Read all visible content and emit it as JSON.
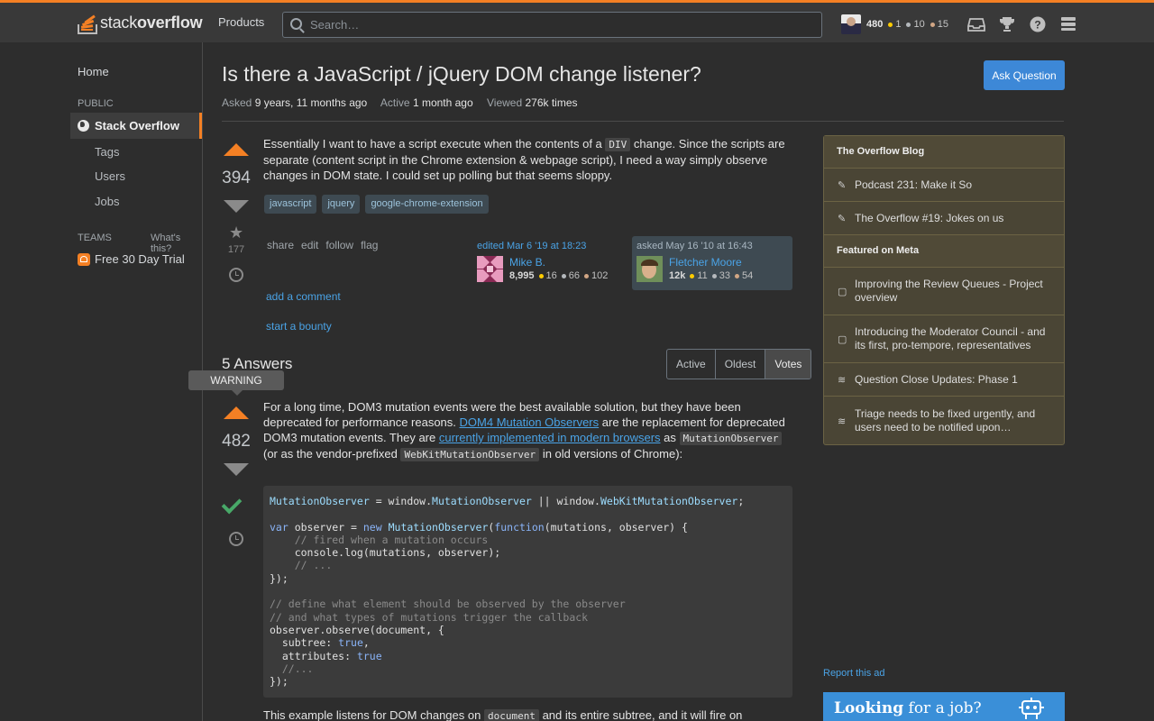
{
  "topbar": {
    "logo_light": "stack",
    "logo_bold": "overflow",
    "products_label": "Products",
    "search_placeholder": "Search…",
    "reputation": "480",
    "gold": "1",
    "silver": "10",
    "bronze": "15"
  },
  "leftnav": {
    "home": "Home",
    "public": "PUBLIC",
    "stack_overflow": "Stack Overflow",
    "tags": "Tags",
    "users": "Users",
    "jobs": "Jobs",
    "teams": "TEAMS",
    "whats_this": "What's this?",
    "trial": "Free 30 Day Trial"
  },
  "question": {
    "title": "Is there a JavaScript / jQuery DOM change listener?",
    "ask_button": "Ask Question",
    "asked_label": "Asked",
    "asked_value": "9 years, 11 months ago",
    "active_label": "Active",
    "active_value": "1 month ago",
    "viewed_label": "Viewed",
    "viewed_value": "276k times",
    "score": "394",
    "favorites": "177",
    "body_1": "Essentially I want to have a script execute when the contents of a",
    "body_code": "DIV",
    "body_2": "change. Since the scripts are separate (content script in the Chrome extension & webpage script), I need a way simply observe changes in DOM state. I could set up polling but that seems sloppy.",
    "tags": [
      "javascript",
      "jquery",
      "google-chrome-extension"
    ],
    "menu": [
      "share",
      "edit",
      "follow",
      "flag"
    ],
    "editor": {
      "head": "edited Mar 6 '19 at 18:23",
      "name": "Mike B.",
      "rep": "8,995",
      "gold": "16",
      "silver": "66",
      "bronze": "102"
    },
    "asker": {
      "head": "asked May 16 '10 at 16:43",
      "name": "Fletcher Moore",
      "rep": "12k",
      "gold": "11",
      "silver": "33",
      "bronze": "54"
    },
    "add_comment": "add a comment",
    "start_bounty": "start a bounty"
  },
  "answers": {
    "heading": "5 Answers",
    "sort_tabs": [
      "Active",
      "Oldest",
      "Votes"
    ],
    "warning": "WARNING",
    "score": "482",
    "p1": "For a long time, DOM3 mutation events were the best available solution, but they have been deprecated for performance reasons.",
    "link1": "DOM4 Mutation Observers",
    "p2": "are the replacement for deprecated DOM3 mutation events. They are",
    "link2": "currently implemented in modern browsers",
    "p3": "as",
    "code1": "MutationObserver",
    "p4": "(or as the vendor-prefixed",
    "code2": "WebKitMutationObserver",
    "p5": "in old versions of Chrome):",
    "bottom_1": "This example listens for DOM changes on",
    "bottom_code": "document",
    "bottom_2": "and its entire subtree, and it will fire on"
  },
  "sidebar": {
    "blog_title": "The Overflow Blog",
    "blog_items": [
      "Podcast 231: Make it So",
      "The Overflow #19: Jokes on us"
    ],
    "meta_title": "Featured on Meta",
    "meta_items": [
      "Improving the Review Queues - Project overview",
      "Introducing the Moderator Council - and its first, pro-tempore, representatives",
      "Question Close Updates: Phase 1",
      "Triage needs to be fixed urgently, and users need to be notified upon…"
    ],
    "report_ad": "Report this ad",
    "ad_bold": "Looking",
    "ad_rest": " for a job?"
  },
  "colors": {
    "accent": "#f48024",
    "link": "#4aa3e6",
    "gold": "#ffcc01",
    "silver": "#b4b8bc",
    "bronze": "#d1a684",
    "accepted": "#48a868"
  }
}
